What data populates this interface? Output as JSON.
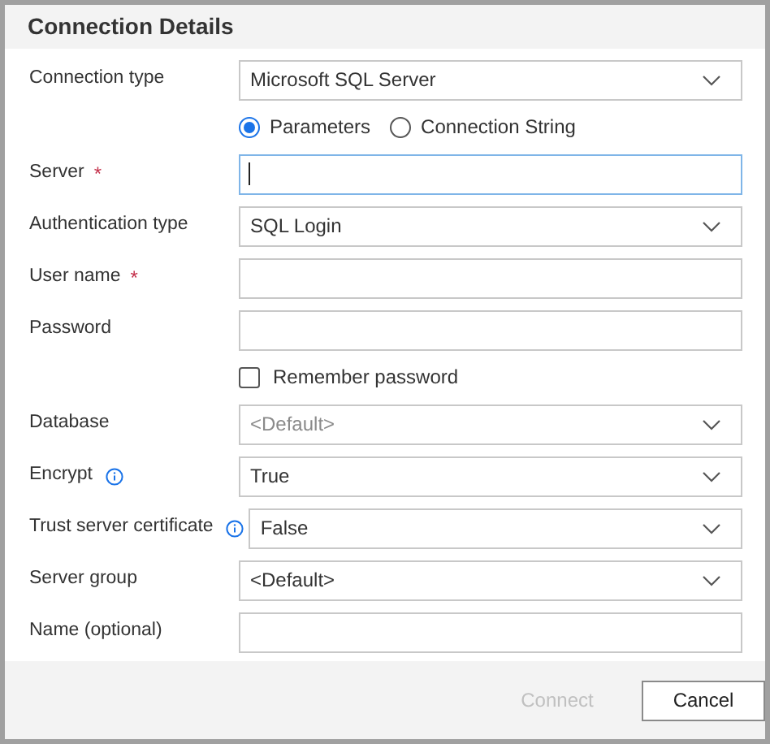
{
  "dialog": {
    "title": "Connection Details"
  },
  "fields": [
    {
      "kind": "select",
      "label": "Connection type",
      "info": false,
      "value": "Microsoft SQL Server"
    },
    {
      "kind": "radio",
      "options": [
        {
          "label": "Parameters",
          "selected": true
        },
        {
          "label": "Connection String",
          "selected": false
        }
      ]
    },
    {
      "kind": "text",
      "label": "Server",
      "required_mark": "*",
      "info": false,
      "focused": true
    },
    {
      "kind": "select",
      "label": "Authentication type",
      "info": false,
      "value": "SQL Login"
    },
    {
      "kind": "text",
      "label": "User name",
      "required_mark": "*",
      "info": false,
      "focused": false
    },
    {
      "kind": "text",
      "label": "Password",
      "info": false,
      "focused": false
    },
    {
      "kind": "checkbox",
      "label": "Remember password",
      "checked": false
    },
    {
      "kind": "select",
      "label": "Database",
      "info": false,
      "placeholder": "<Default>"
    },
    {
      "kind": "select",
      "label": "Encrypt",
      "info": true,
      "value": "True"
    },
    {
      "kind": "select",
      "label": "Trust server certificate",
      "info": true,
      "value": "False"
    },
    {
      "kind": "select",
      "label": "Server group",
      "info": false,
      "value": "<Default>"
    },
    {
      "kind": "text",
      "label": "Name (optional)",
      "info": false,
      "focused": false
    }
  ],
  "buttons": [
    {
      "label": "Connect",
      "disabled": true
    },
    {
      "label": "Cancel",
      "disabled": false
    }
  ]
}
